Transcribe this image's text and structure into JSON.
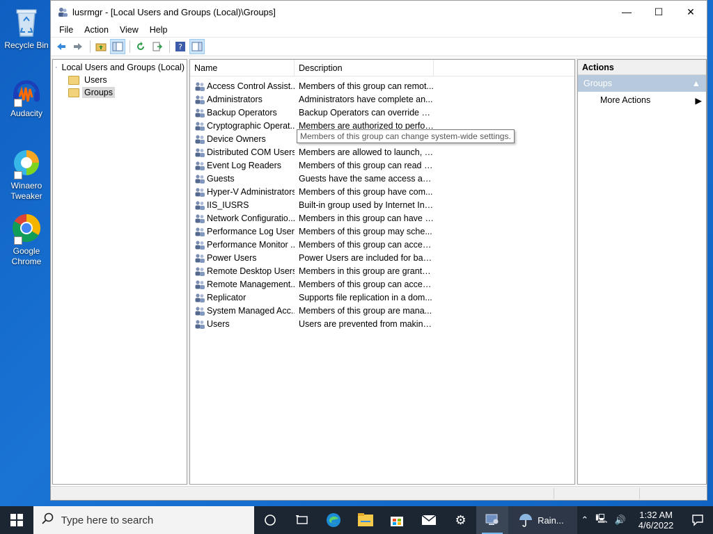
{
  "desktop": {
    "icons": [
      {
        "label": "Recycle Bin"
      },
      {
        "label": "Audacity"
      },
      {
        "label": "Winaero Tweaker"
      },
      {
        "label": "Google Chrome"
      }
    ]
  },
  "window": {
    "title": "lusrmgr - [Local Users and Groups (Local)\\Groups]",
    "menu": [
      "File",
      "Action",
      "View",
      "Help"
    ]
  },
  "tree": {
    "root": "Local Users and Groups (Local)",
    "children": [
      "Users",
      "Groups"
    ],
    "selected": "Groups"
  },
  "list": {
    "columns": {
      "name": "Name",
      "description": "Description"
    },
    "rows": [
      {
        "name": "Access Control Assist...",
        "description": "Members of this group can remot..."
      },
      {
        "name": "Administrators",
        "description": "Administrators have complete an..."
      },
      {
        "name": "Backup Operators",
        "description": "Backup Operators can override se..."
      },
      {
        "name": "Cryptographic Operat...",
        "description": "Members are authorized to perfor..."
      },
      {
        "name": "Device Owners",
        "description": ""
      },
      {
        "name": "Distributed COM Users",
        "description": "Members are allowed to launch, a..."
      },
      {
        "name": "Event Log Readers",
        "description": "Members of this group can read e..."
      },
      {
        "name": "Guests",
        "description": "Guests have the same access as m..."
      },
      {
        "name": "Hyper-V Administrators",
        "description": "Members of this group have com..."
      },
      {
        "name": "IIS_IUSRS",
        "description": "Built-in group used by Internet Inf..."
      },
      {
        "name": "Network Configuratio...",
        "description": "Members in this group can have s..."
      },
      {
        "name": "Performance Log Users",
        "description": "Members of this group may sche..."
      },
      {
        "name": "Performance Monitor ...",
        "description": "Members of this group can acces..."
      },
      {
        "name": "Power Users",
        "description": "Power Users are included for back..."
      },
      {
        "name": "Remote Desktop Users",
        "description": "Members in this group are grante..."
      },
      {
        "name": "Remote Management...",
        "description": "Members of this group can acces..."
      },
      {
        "name": "Replicator",
        "description": "Supports file replication in a dom..."
      },
      {
        "name": "System Managed Acc...",
        "description": "Members of this group are mana..."
      },
      {
        "name": "Users",
        "description": "Users are prevented from making ..."
      }
    ],
    "tooltip": "Members of this group can change system-wide settings."
  },
  "actions": {
    "title": "Actions",
    "section": "Groups",
    "items": [
      "More Actions"
    ]
  },
  "taskbar": {
    "search_placeholder": "Type here to search",
    "weather": "Rain...",
    "time": "1:32 AM",
    "date": "4/6/2022"
  }
}
